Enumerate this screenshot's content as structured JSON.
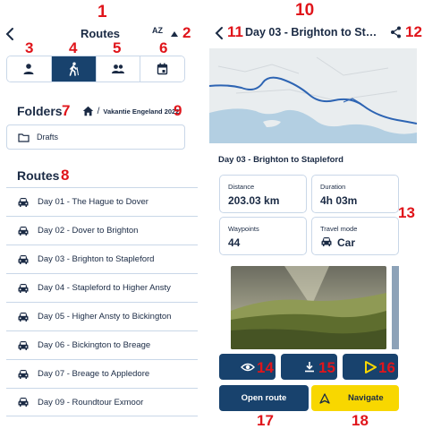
{
  "left": {
    "header": {
      "title": "Routes",
      "sort_label": "AZ"
    },
    "tabs": [
      {
        "name": "person-icon",
        "active": false
      },
      {
        "name": "hiker-icon",
        "active": true
      },
      {
        "name": "group-icon",
        "active": false
      },
      {
        "name": "calendar-icon",
        "active": false
      }
    ],
    "folders": {
      "title": "Folders",
      "separator": "/",
      "breadcrumb": "Vakantie Engeland 2022",
      "items": [
        "Drafts"
      ]
    },
    "routes": {
      "title": "Routes",
      "items": [
        "Day 01 - The Hague to Dover",
        "Day 02 - Dover to Brighton",
        "Day 03 - Brighton to Stapleford",
        "Day 04 - Stapleford to Higher Ansty",
        "Day 05 - Higher Ansty to Bickington",
        "Day 06 - Bickington to Breage",
        "Day 07 - Breage to Appledore",
        "Day 09 - Roundtour Exmoor"
      ]
    }
  },
  "right": {
    "header": {
      "title": "Day 03 - Brighton to St…"
    },
    "detail_title": "Day 03 - Brighton to Stapleford",
    "stats": {
      "distance": {
        "label": "Distance",
        "value": "203.03 km"
      },
      "duration": {
        "label": "Duration",
        "value": "4h 03m"
      },
      "waypoints": {
        "label": "Waypoints",
        "value": "44"
      },
      "travel_mode": {
        "label": "Travel mode",
        "value": "Car"
      }
    },
    "buttons": {
      "open_route": "Open route",
      "navigate": "Navigate"
    }
  },
  "annotations": [
    "1",
    "2",
    "3",
    "4",
    "5",
    "6",
    "7",
    "8",
    "9",
    "10",
    "11",
    "12",
    "13",
    "14",
    "15",
    "16",
    "17",
    "18"
  ],
  "colors": {
    "primary": "#18426d",
    "accent": "#f8d700",
    "border": "#c9d7e8",
    "annotation": "#e0151b"
  }
}
